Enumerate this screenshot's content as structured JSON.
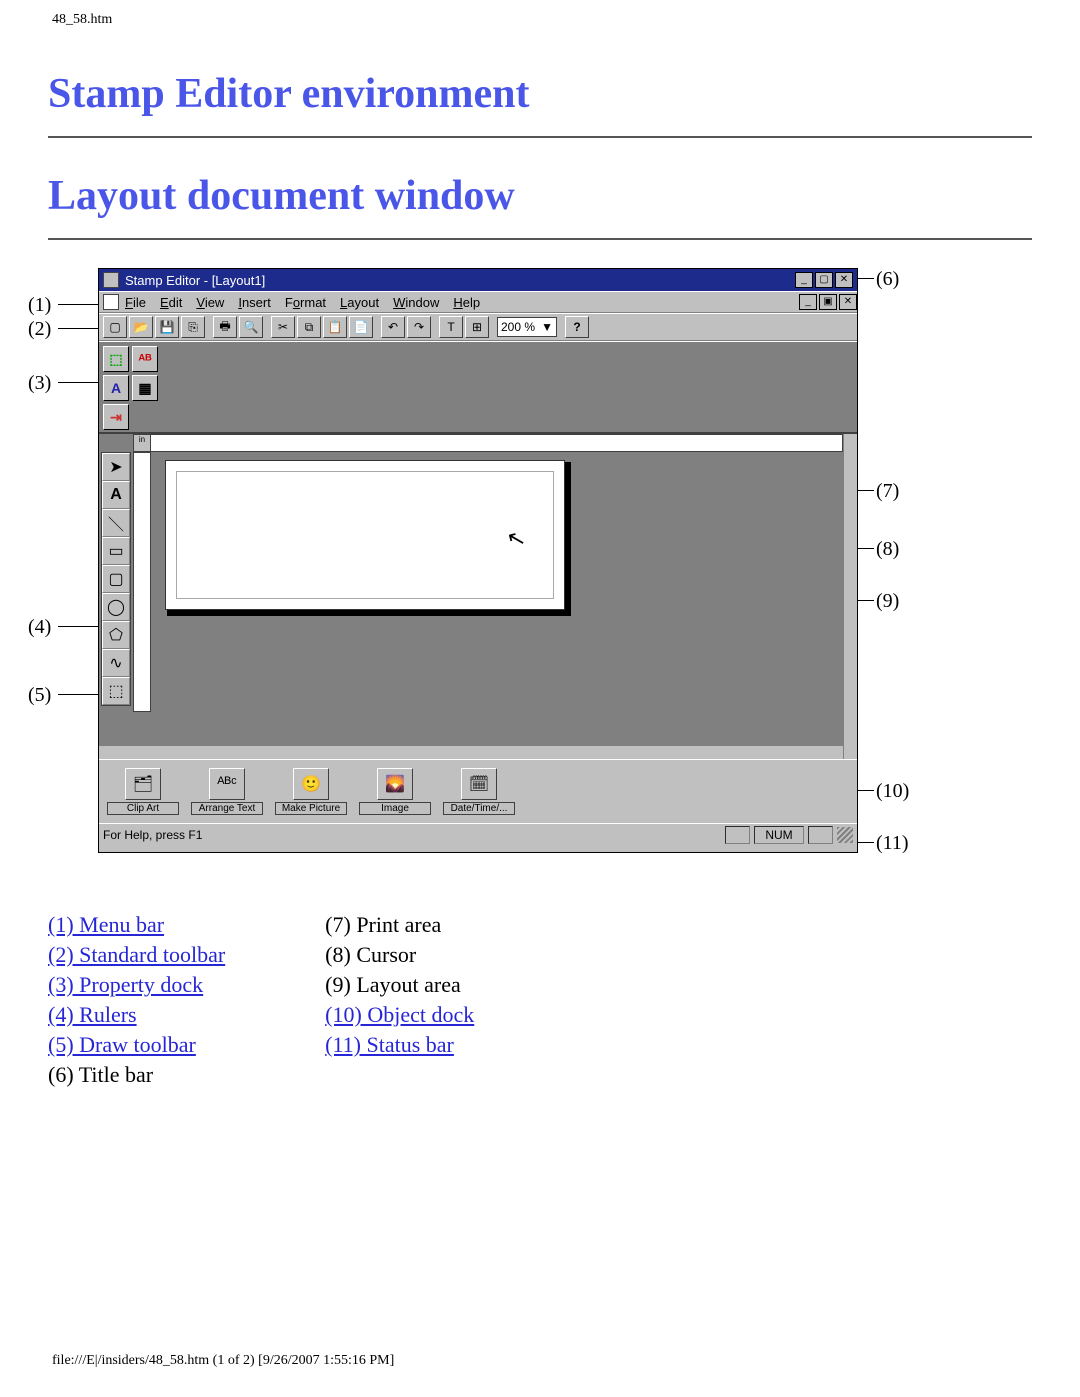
{
  "header_label": "48_58.htm",
  "h1_env": "Stamp Editor environment",
  "h1_layout": "Layout document window",
  "app": {
    "title": "Stamp Editor - [Layout1]",
    "menu": [
      "File",
      "Edit",
      "View",
      "Insert",
      "Format",
      "Layout",
      "Window",
      "Help"
    ],
    "zoom": "200 %",
    "ruler_unit": "in",
    "object_dock": [
      {
        "label": "Clip Art",
        "icon": "🗂"
      },
      {
        "label": "Arrange Text",
        "icon": "ᴬᴮᶜ"
      },
      {
        "label": "Make Picture",
        "icon": "🙂"
      },
      {
        "label": "Image",
        "icon": "🌄"
      },
      {
        "label": "Date/Time/...",
        "icon": "🗓"
      }
    ],
    "status_left": "For Help, press F1",
    "status_num": "NUM"
  },
  "callouts_left": [
    "(1)",
    "(2)",
    "(3)",
    "(4)",
    "(5)"
  ],
  "callouts_right": [
    "(6)",
    "(7)",
    "(8)",
    "(9)",
    "(10)",
    "(11)"
  ],
  "legend_left": [
    {
      "label": "(1) Menu bar",
      "link": true
    },
    {
      "label": "(2) Standard toolbar",
      "link": true
    },
    {
      "label": "(3) Property dock",
      "link": true
    },
    {
      "label": "(4) Rulers",
      "link": true
    },
    {
      "label": "(5) Draw toolbar",
      "link": true
    },
    {
      "label": "(6) Title bar",
      "link": false
    }
  ],
  "legend_right": [
    {
      "label": "(7) Print area",
      "link": false
    },
    {
      "label": "(8) Cursor",
      "link": false
    },
    {
      "label": "(9) Layout area",
      "link": false
    },
    {
      "label": "(10) Object dock",
      "link": true
    },
    {
      "label": "(11) Status bar",
      "link": true
    }
  ],
  "footer_label": "file:///E|/insiders/48_58.htm (1 of 2) [9/26/2007 1:55:16 PM]"
}
